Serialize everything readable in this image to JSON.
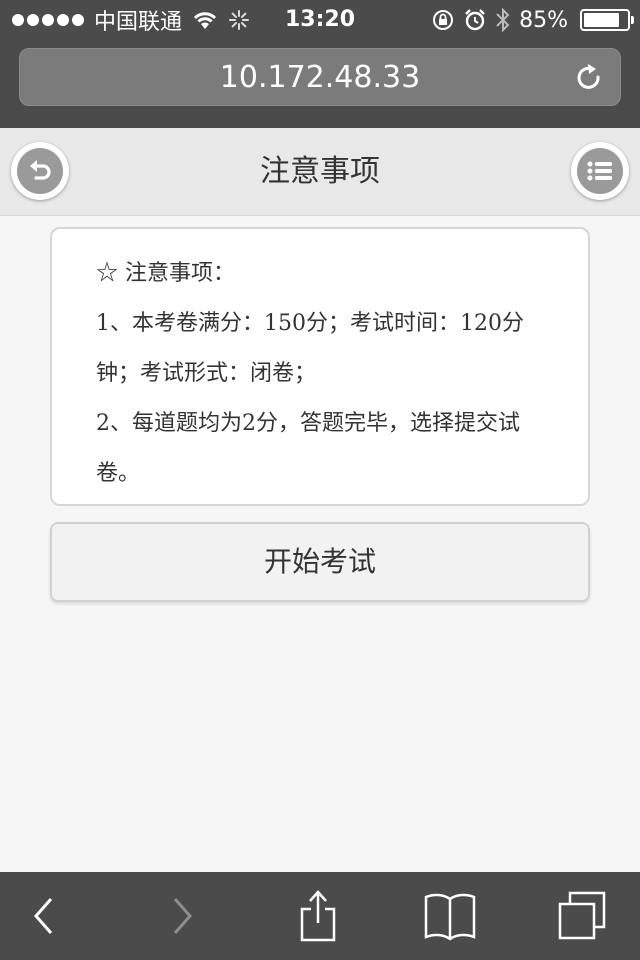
{
  "status_bar": {
    "carrier": "中国联通",
    "time": "13:20",
    "battery_text": "85%",
    "battery_level": 0.85
  },
  "address_bar": {
    "url": "10.172.48.33"
  },
  "header": {
    "title": "注意事项"
  },
  "notice": {
    "heading": "☆ 注意事项：",
    "item1": "1、本考卷满分：150分；考试时间：120分钟；考试形式：闭卷；",
    "item2": "2、每道题均为2分，答题完毕，选择提交试卷。"
  },
  "start_button": {
    "label": "开始考试"
  },
  "icons": {
    "back": "back-arrow-icon",
    "menu": "list-menu-icon",
    "reload": "reload-icon",
    "browser_back": "chevron-left-icon",
    "browser_forward": "chevron-right-icon",
    "share": "share-icon",
    "bookmarks": "book-icon",
    "tabs": "tabs-icon"
  },
  "colors": {
    "chrome_bg": "#4b4b4b",
    "header_bg": "#e8e8e8",
    "page_bg": "#f6f6f6"
  }
}
